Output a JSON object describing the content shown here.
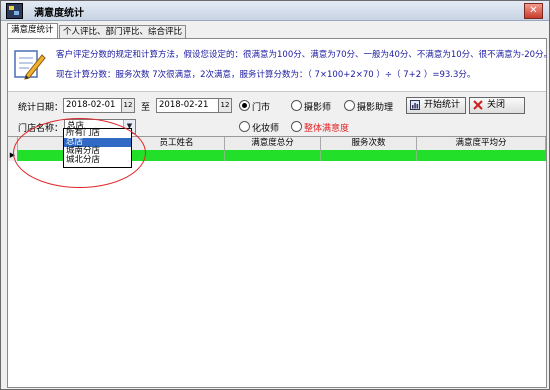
{
  "window": {
    "title": "满意度统计",
    "close_label": "✕"
  },
  "tabs": [
    {
      "label": "满意度统计",
      "active": true
    },
    {
      "label": "个人评比、部门评比、综合评比",
      "active": false
    }
  ],
  "info": {
    "line1": "客户评定分数的规定和计算方法，假设您设定的：很满意为100分、满意为70分、一般为40分、不满意为10分、很不满意为-20分。",
    "line2": "现在计算分数：服务次数  7次很满意，2次满意，服务计算分数为：（ 7×100+2×70 ）÷（ 7+2 ）=93.3分。"
  },
  "filter": {
    "date_label": "统计日期：",
    "date_from": "2018-02-01",
    "to_label": "至",
    "date_to": "2018-02-21",
    "date_button": "12",
    "store_label": "门店名称：",
    "store_selected": "总店",
    "store_options": [
      "所有门店",
      "总店",
      "城南分店",
      "城北分店"
    ],
    "radio_options": [
      {
        "label": "门市",
        "checked": true
      },
      {
        "label": "摄影师",
        "checked": false
      },
      {
        "label": "摄影助理",
        "checked": false
      },
      {
        "label": "化妆师",
        "checked": false
      }
    ],
    "overall_label": "整体满意度",
    "overall_color": "#e0262a",
    "start_button": "开始统计",
    "close_button": "关闭"
  },
  "grid": {
    "columns": [
      "门店",
      "员工姓名",
      "满意度总分",
      "服务次数",
      "满意度平均分"
    ],
    "row_indicator": "▶",
    "row_color": "#22e02a"
  },
  "colors": {
    "highlight": "#316ac5",
    "annotation": "#e0262a"
  }
}
